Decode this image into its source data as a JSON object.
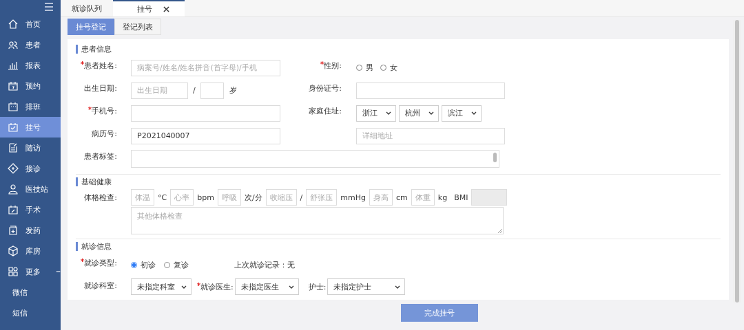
{
  "sidebar": {
    "items": [
      {
        "label": "首页",
        "selected": false
      },
      {
        "label": "患者",
        "selected": false
      },
      {
        "label": "报表",
        "selected": false
      },
      {
        "label": "预约",
        "selected": false
      },
      {
        "label": "排班",
        "selected": false
      },
      {
        "label": "挂号",
        "selected": true
      },
      {
        "label": "随访",
        "selected": false
      },
      {
        "label": "接诊",
        "selected": false
      },
      {
        "label": "医技站",
        "selected": false
      },
      {
        "label": "手术",
        "selected": false
      },
      {
        "label": "发药",
        "selected": false
      },
      {
        "label": "库房",
        "selected": false
      },
      {
        "label": "更多",
        "selected": false,
        "expanded": true,
        "children": [
          {
            "label": "微信",
            "selected": false
          },
          {
            "label": "短信",
            "selected": false
          }
        ]
      }
    ]
  },
  "tabs": [
    {
      "label": "就诊队列",
      "selected": false,
      "closable": false
    },
    {
      "label": "挂号",
      "selected": true,
      "closable": true
    }
  ],
  "subtabs": [
    {
      "label": "挂号登记",
      "selected": true
    },
    {
      "label": "登记列表",
      "selected": false
    }
  ],
  "patient_info": {
    "title": "患者信息",
    "name": {
      "label": "患者姓名:",
      "required": true,
      "placeholder": "病案号/姓名/姓名拼音(首字母)/手机"
    },
    "gender": {
      "label": "性别:",
      "required": true,
      "options": [
        {
          "label": "男",
          "selected": false
        },
        {
          "label": "女",
          "selected": false
        }
      ]
    },
    "birth": {
      "label": "出生日期:",
      "required": false,
      "placeholder": "出生日期",
      "separator": "/",
      "unit": "岁"
    },
    "id_number": {
      "label": "身份证号:",
      "required": false
    },
    "phone": {
      "label": "手机号:",
      "required": true
    },
    "address": {
      "label": "家庭住址:",
      "required": false,
      "selects": [
        "浙江",
        "杭州",
        "滨江"
      ],
      "detail_placeholder": "详细地址"
    },
    "record_number": {
      "label": "病历号:",
      "required": false,
      "value": "P2021040007"
    },
    "tags": {
      "label": "患者标签:",
      "required": false
    }
  },
  "health": {
    "title": "基础健康",
    "label": "体格检查:",
    "items": [
      {
        "kind": "input",
        "placeholder": "体温"
      },
      {
        "kind": "unit",
        "text": "°C"
      },
      {
        "kind": "input",
        "placeholder": "心率"
      },
      {
        "kind": "unit",
        "text": "bpm"
      },
      {
        "kind": "input",
        "placeholder": "呼吸"
      },
      {
        "kind": "unit",
        "text": "次/分"
      },
      {
        "kind": "input",
        "placeholder": "收缩压"
      },
      {
        "kind": "unit",
        "text": "/"
      },
      {
        "kind": "input",
        "placeholder": "舒张压"
      },
      {
        "kind": "unit",
        "text": "mmHg"
      },
      {
        "kind": "input",
        "placeholder": "身高"
      },
      {
        "kind": "unit",
        "text": "cm"
      },
      {
        "kind": "input",
        "placeholder": "体重"
      },
      {
        "kind": "unit",
        "text": "kg"
      },
      {
        "kind": "unit",
        "text": "BMI"
      },
      {
        "kind": "readonly"
      }
    ],
    "other_placeholder": "其他体格检查"
  },
  "visit": {
    "title": "就诊信息",
    "type": {
      "label": "就诊类型:",
      "required": true,
      "options": [
        {
          "label": "初诊",
          "selected": true
        },
        {
          "label": "复诊",
          "selected": false
        }
      ]
    },
    "last_record": "上次就诊记录：无",
    "department": {
      "label": "就诊科室:",
      "required": false,
      "value": "未指定科室"
    },
    "doctor": {
      "label": "就诊医生:",
      "required": true,
      "value": "未指定医生"
    },
    "nurse": {
      "label": "护士:",
      "required": false,
      "value": "未指定护士"
    }
  },
  "submit_button": "完成挂号"
}
